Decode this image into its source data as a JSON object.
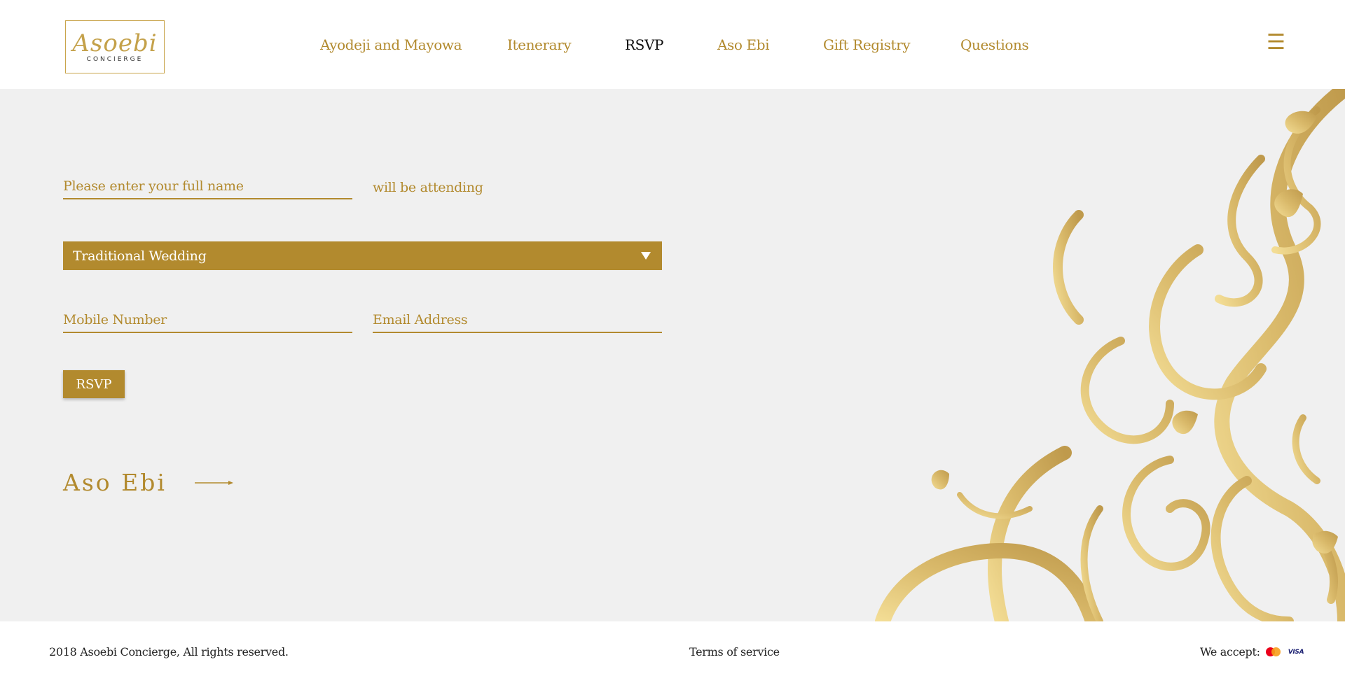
{
  "brand": {
    "logo_script": "Asoebi",
    "logo_sub": "CONCIERGE"
  },
  "nav": {
    "items": [
      {
        "label": "Ayodeji and Mayowa"
      },
      {
        "label": "Itenerary"
      },
      {
        "label": "RSVP",
        "active": true
      },
      {
        "label": "Aso Ebi"
      },
      {
        "label": "Gift Registry"
      },
      {
        "label": "Questions"
      }
    ],
    "menu_icon": "hamburger-menu-icon",
    "menu_glyph": "☰"
  },
  "form": {
    "name_placeholder": "Please enter your full name",
    "name_value": "",
    "attending_text": "will be attending",
    "event_selected": "Traditional Wedding",
    "mobile_placeholder": "Mobile Number",
    "email_placeholder": "Email Address",
    "submit_label": "RSVP"
  },
  "next_link": {
    "label": "Aso Ebi",
    "icon": "long-arrow-right-icon"
  },
  "footer": {
    "copyright": "2018 Asoebi Concierge, All rights reserved.",
    "terms": "Terms of service",
    "accept_label": "We accept:",
    "cards": [
      "mastercard-icon",
      "visa-icon"
    ],
    "visa_text": "VISA"
  },
  "colors": {
    "gold": "#b28a2e",
    "background": "#f0f0f0",
    "header": "#ffffff"
  }
}
